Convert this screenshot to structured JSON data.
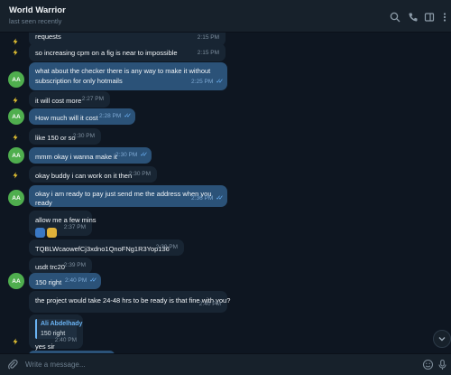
{
  "header": {
    "title": "World Warrior",
    "status": "last seen recently"
  },
  "messages": [
    {
      "side": "in",
      "avatar": "bolt",
      "text": "requests",
      "time": "2:15 PM",
      "partial": true
    },
    {
      "side": "in",
      "avatar": "bolt",
      "text": "so increasing cpm on a fig is near to impossible",
      "time": "2:15 PM"
    },
    {
      "side": "out",
      "avatar": "AA",
      "text": "what about the checker there is any way to make it without subscription for only hotmails",
      "time": "2:25 PM"
    },
    {
      "side": "in",
      "avatar": "bolt",
      "text": "it will cost more",
      "time": "2:27 PM"
    },
    {
      "side": "out",
      "avatar": "AA",
      "text": "How much will it cost",
      "time": "2:28 PM"
    },
    {
      "side": "in",
      "avatar": "bolt",
      "text": "like 150 or so",
      "time": "2:30 PM"
    },
    {
      "side": "out",
      "avatar": "AA",
      "text": "mmm okay i wanna make it",
      "time": "2:30 PM"
    },
    {
      "side": "in",
      "avatar": "bolt",
      "text": "okay buddy i can work on it then",
      "time": "2:30 PM"
    },
    {
      "side": "out",
      "avatar": "AA",
      "text": "okay i am ready to pay just send me the address when you ready",
      "time": "2:36 PM"
    },
    {
      "side": "in",
      "avatar": "none",
      "text": "allow me a few mins",
      "time": "2:37 PM",
      "reactions": true
    },
    {
      "side": "in",
      "avatar": "none",
      "text": "TQBLWcaowefCj3xdno1QnoFNg1R3Yop136",
      "time": "2:39 PM"
    },
    {
      "side": "in",
      "avatar": "none",
      "text": "usdt trc20",
      "time": "2:39 PM"
    },
    {
      "side": "out",
      "avatar": "AA",
      "text": "150 right",
      "time": "2:40 PM"
    },
    {
      "side": "in",
      "avatar": "none",
      "text": "the project would take 24-48 hrs to be ready is that fine with you?",
      "time": "2:40 PM"
    },
    {
      "side": "in",
      "avatar": "bolt",
      "text": "yes sir",
      "time": "2:40 PM",
      "reply": {
        "name": "Ali Abdelhady",
        "text": "150 right"
      }
    }
  ],
  "input": {
    "placeholder": "Write a message..."
  },
  "colors": {
    "background": "#0e1621",
    "incoming": "#182533",
    "outgoing": "#2b5278",
    "accent": "#6ab3f3",
    "avatar_aa": "#4fae4e"
  },
  "icons": [
    "search-icon",
    "phone-icon",
    "columns-icon",
    "more-icon",
    "bolt-icon",
    "double-check-icon",
    "paperclip-icon",
    "smile-icon",
    "mic-icon",
    "chevron-down-icon"
  ]
}
